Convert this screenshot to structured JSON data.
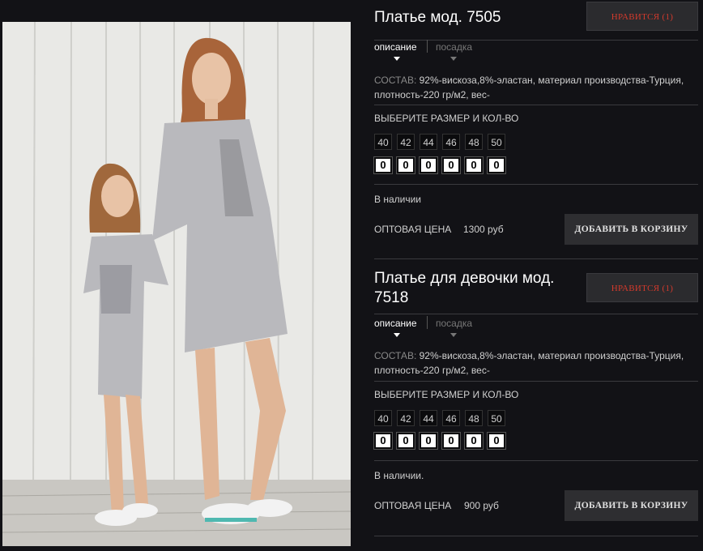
{
  "colors": {
    "background": "#121216",
    "like_text": "#d33a2c",
    "button_bg": "#2e2e31",
    "active_text": "#ffffff",
    "muted_text": "#777777"
  },
  "products": [
    {
      "title": "Платье мод. 7505",
      "like_label": "НРАВИТСЯ (1)",
      "tab_description": "описание",
      "tab_fit": "посадка",
      "composition_label": "СОСТАВ:",
      "composition_text": "92%-вискоза,8%-эластан, материал производства-Турция, плотность-220 гр/м2, вес-",
      "size_prompt": "ВЫБЕРИТЕ РАЗМЕР И КОЛ-ВО",
      "sizes": [
        "40",
        "42",
        "44",
        "46",
        "48",
        "50"
      ],
      "quantities": [
        "0",
        "0",
        "0",
        "0",
        "0",
        "0"
      ],
      "availability": "В наличии",
      "price_label": "ОПТОВАЯ ЦЕНА",
      "price_value": "1300 руб",
      "cart_label": "ДОБАВИТЬ В КОРЗИНУ"
    },
    {
      "title": "Платье для девочки мод. 7518",
      "like_label": "НРАВИТСЯ (1)",
      "tab_description": "описание",
      "tab_fit": "посадка",
      "composition_label": "СОСТАВ:",
      "composition_text": "92%-вискоза,8%-эластан, материал производства-Турция, плотность-220 гр/м2, вес-",
      "size_prompt": "ВЫБЕРИТЕ РАЗМЕР И КОЛ-ВО",
      "sizes": [
        "40",
        "42",
        "44",
        "46",
        "48",
        "50"
      ],
      "quantities": [
        "0",
        "0",
        "0",
        "0",
        "0",
        "0"
      ],
      "availability": "В наличии.",
      "price_label": "ОПТОВАЯ ЦЕНА",
      "price_value": "900 руб",
      "cart_label": "ДОБАВИТЬ В КОРЗИНУ"
    }
  ]
}
